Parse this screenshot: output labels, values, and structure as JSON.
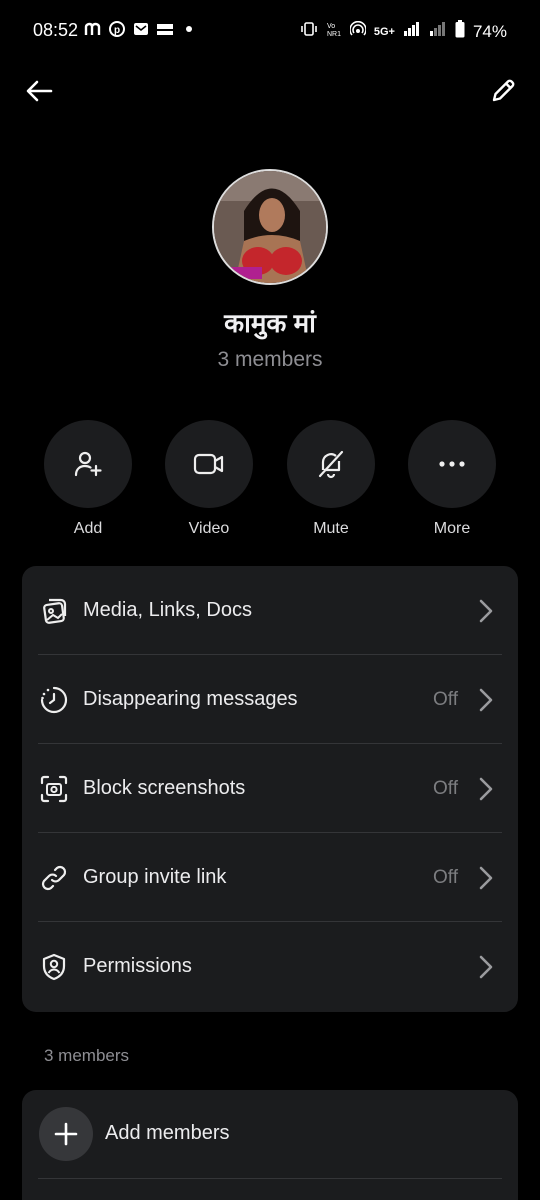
{
  "status_bar": {
    "time": "08:52",
    "app_icons": [
      "m",
      "p",
      "mail",
      "insta"
    ],
    "network": "5G+",
    "battery": "74%"
  },
  "group": {
    "name": "कामुक मां",
    "members_count": "3 members"
  },
  "actions": [
    {
      "label": "Add",
      "icon": "add-person-icon"
    },
    {
      "label": "Video",
      "icon": "video-icon"
    },
    {
      "label": "Mute",
      "icon": "bell-off-icon"
    },
    {
      "label": "More",
      "icon": "more-horizontal-icon"
    }
  ],
  "settings": [
    {
      "title": "Media, Links, Docs",
      "value": "",
      "icon": "media-icon"
    },
    {
      "title": "Disappearing messages",
      "value": "Off",
      "icon": "timer-icon"
    },
    {
      "title": "Block screenshots",
      "value": "Off",
      "icon": "screenshot-icon"
    },
    {
      "title": "Group invite link",
      "value": "Off",
      "icon": "link-icon"
    },
    {
      "title": "Permissions",
      "value": "",
      "icon": "shield-user-icon"
    }
  ],
  "members": {
    "section_label": "3 members",
    "add_label": "Add members"
  }
}
